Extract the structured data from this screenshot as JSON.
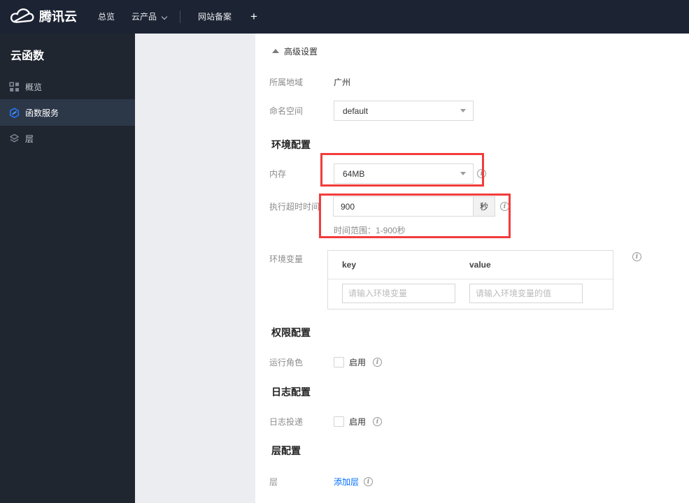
{
  "colors": {
    "accent": "#006eff",
    "annotation_red": "#f23c3c",
    "navbar_bg": "#1c2433",
    "sidebar_bg": "#1f2630"
  },
  "navbar": {
    "brand": "腾讯云",
    "items": [
      {
        "label": "总览"
      },
      {
        "label": "云产品"
      },
      {
        "label": "网站备案"
      }
    ],
    "plus_label": "+"
  },
  "sidebar": {
    "title": "云函数",
    "items": [
      {
        "label": "概览",
        "icon": "overview-grid-icon",
        "active": false
      },
      {
        "label": "函数服务",
        "icon": "scf-hexagon-icon",
        "active": true
      },
      {
        "label": "层",
        "icon": "layers-icon",
        "active": false
      }
    ]
  },
  "main": {
    "collapse_label": "高级设置",
    "region": {
      "label": "所属地域",
      "value": "广州"
    },
    "namespace": {
      "label": "命名空间",
      "value": "default"
    },
    "sections": {
      "env": "环境配置",
      "perm": "权限配置",
      "log": "日志配置",
      "layer": "层配置"
    },
    "memory": {
      "label": "内存",
      "value": "64MB"
    },
    "timeout": {
      "label": "执行超时时间",
      "value": "900",
      "unit": "秒",
      "hint": "时间范围：1-900秒"
    },
    "env_vars": {
      "label": "环境变量",
      "key_header": "key",
      "value_header": "value",
      "key_placeholder": "请输入环境变量",
      "value_placeholder": "请输入环境变量的值"
    },
    "role": {
      "label": "运行角色",
      "checkbox_label": "启用"
    },
    "log_delivery": {
      "label": "日志投递",
      "checkbox_label": "启用"
    },
    "layer": {
      "label": "层",
      "add_label": "添加层"
    }
  }
}
